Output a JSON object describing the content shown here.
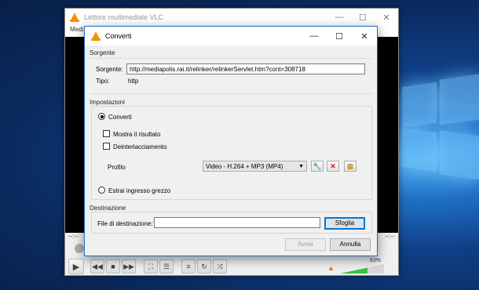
{
  "vlc": {
    "title": "Lettore multimediale VLC",
    "menu": "Medi",
    "time_left": "--:--",
    "time_right": "--:--",
    "volume_percent": "63%",
    "volume_level": 0.63
  },
  "dialog": {
    "title": "Converti",
    "source": {
      "group_label": "Sorgente",
      "source_label": "Sorgente:",
      "source_value": "http://mediapolis.rai.it/relinker/relinkerServlet.htm?cont=308718",
      "type_label": "Tipo:",
      "type_value": "http"
    },
    "settings": {
      "group_label": "Impostazioni",
      "convert_label": "Converti",
      "show_result_label": "Mostra il risultato",
      "deinterlace_label": "Deinterlacciamento",
      "profile_label": "Profilo",
      "profile_value": "Video - H.264 + MP3 (MP4)",
      "raw_input_label": "Estrai ingresso grezzo"
    },
    "destination": {
      "group_label": "Destinazione",
      "file_label": "File di destinazione:",
      "file_value": "",
      "browse_label": "Sfoglia"
    },
    "buttons": {
      "start_label": "Avvia",
      "cancel_label": "Annulla"
    }
  },
  "colors": {
    "accent": "#0078d7",
    "vlc_orange": "#f39000",
    "volume_green": "#3cc43c",
    "delete_red": "#d01818"
  }
}
